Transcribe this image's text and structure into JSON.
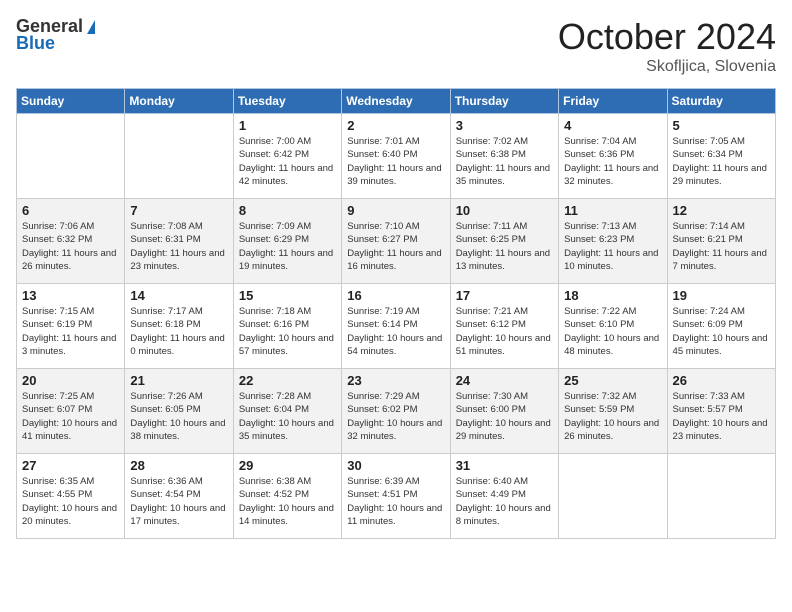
{
  "header": {
    "logo_general": "General",
    "logo_blue": "Blue",
    "title": "October 2024",
    "location": "Skofljica, Slovenia"
  },
  "weekdays": [
    "Sunday",
    "Monday",
    "Tuesday",
    "Wednesday",
    "Thursday",
    "Friday",
    "Saturday"
  ],
  "weeks": [
    [
      {
        "day": "",
        "sunrise": "",
        "sunset": "",
        "daylight": ""
      },
      {
        "day": "",
        "sunrise": "",
        "sunset": "",
        "daylight": ""
      },
      {
        "day": "1",
        "sunrise": "Sunrise: 7:00 AM",
        "sunset": "Sunset: 6:42 PM",
        "daylight": "Daylight: 11 hours and 42 minutes."
      },
      {
        "day": "2",
        "sunrise": "Sunrise: 7:01 AM",
        "sunset": "Sunset: 6:40 PM",
        "daylight": "Daylight: 11 hours and 39 minutes."
      },
      {
        "day": "3",
        "sunrise": "Sunrise: 7:02 AM",
        "sunset": "Sunset: 6:38 PM",
        "daylight": "Daylight: 11 hours and 35 minutes."
      },
      {
        "day": "4",
        "sunrise": "Sunrise: 7:04 AM",
        "sunset": "Sunset: 6:36 PM",
        "daylight": "Daylight: 11 hours and 32 minutes."
      },
      {
        "day": "5",
        "sunrise": "Sunrise: 7:05 AM",
        "sunset": "Sunset: 6:34 PM",
        "daylight": "Daylight: 11 hours and 29 minutes."
      }
    ],
    [
      {
        "day": "6",
        "sunrise": "Sunrise: 7:06 AM",
        "sunset": "Sunset: 6:32 PM",
        "daylight": "Daylight: 11 hours and 26 minutes."
      },
      {
        "day": "7",
        "sunrise": "Sunrise: 7:08 AM",
        "sunset": "Sunset: 6:31 PM",
        "daylight": "Daylight: 11 hours and 23 minutes."
      },
      {
        "day": "8",
        "sunrise": "Sunrise: 7:09 AM",
        "sunset": "Sunset: 6:29 PM",
        "daylight": "Daylight: 11 hours and 19 minutes."
      },
      {
        "day": "9",
        "sunrise": "Sunrise: 7:10 AM",
        "sunset": "Sunset: 6:27 PM",
        "daylight": "Daylight: 11 hours and 16 minutes."
      },
      {
        "day": "10",
        "sunrise": "Sunrise: 7:11 AM",
        "sunset": "Sunset: 6:25 PM",
        "daylight": "Daylight: 11 hours and 13 minutes."
      },
      {
        "day": "11",
        "sunrise": "Sunrise: 7:13 AM",
        "sunset": "Sunset: 6:23 PM",
        "daylight": "Daylight: 11 hours and 10 minutes."
      },
      {
        "day": "12",
        "sunrise": "Sunrise: 7:14 AM",
        "sunset": "Sunset: 6:21 PM",
        "daylight": "Daylight: 11 hours and 7 minutes."
      }
    ],
    [
      {
        "day": "13",
        "sunrise": "Sunrise: 7:15 AM",
        "sunset": "Sunset: 6:19 PM",
        "daylight": "Daylight: 11 hours and 3 minutes."
      },
      {
        "day": "14",
        "sunrise": "Sunrise: 7:17 AM",
        "sunset": "Sunset: 6:18 PM",
        "daylight": "Daylight: 11 hours and 0 minutes."
      },
      {
        "day": "15",
        "sunrise": "Sunrise: 7:18 AM",
        "sunset": "Sunset: 6:16 PM",
        "daylight": "Daylight: 10 hours and 57 minutes."
      },
      {
        "day": "16",
        "sunrise": "Sunrise: 7:19 AM",
        "sunset": "Sunset: 6:14 PM",
        "daylight": "Daylight: 10 hours and 54 minutes."
      },
      {
        "day": "17",
        "sunrise": "Sunrise: 7:21 AM",
        "sunset": "Sunset: 6:12 PM",
        "daylight": "Daylight: 10 hours and 51 minutes."
      },
      {
        "day": "18",
        "sunrise": "Sunrise: 7:22 AM",
        "sunset": "Sunset: 6:10 PM",
        "daylight": "Daylight: 10 hours and 48 minutes."
      },
      {
        "day": "19",
        "sunrise": "Sunrise: 7:24 AM",
        "sunset": "Sunset: 6:09 PM",
        "daylight": "Daylight: 10 hours and 45 minutes."
      }
    ],
    [
      {
        "day": "20",
        "sunrise": "Sunrise: 7:25 AM",
        "sunset": "Sunset: 6:07 PM",
        "daylight": "Daylight: 10 hours and 41 minutes."
      },
      {
        "day": "21",
        "sunrise": "Sunrise: 7:26 AM",
        "sunset": "Sunset: 6:05 PM",
        "daylight": "Daylight: 10 hours and 38 minutes."
      },
      {
        "day": "22",
        "sunrise": "Sunrise: 7:28 AM",
        "sunset": "Sunset: 6:04 PM",
        "daylight": "Daylight: 10 hours and 35 minutes."
      },
      {
        "day": "23",
        "sunrise": "Sunrise: 7:29 AM",
        "sunset": "Sunset: 6:02 PM",
        "daylight": "Daylight: 10 hours and 32 minutes."
      },
      {
        "day": "24",
        "sunrise": "Sunrise: 7:30 AM",
        "sunset": "Sunset: 6:00 PM",
        "daylight": "Daylight: 10 hours and 29 minutes."
      },
      {
        "day": "25",
        "sunrise": "Sunrise: 7:32 AM",
        "sunset": "Sunset: 5:59 PM",
        "daylight": "Daylight: 10 hours and 26 minutes."
      },
      {
        "day": "26",
        "sunrise": "Sunrise: 7:33 AM",
        "sunset": "Sunset: 5:57 PM",
        "daylight": "Daylight: 10 hours and 23 minutes."
      }
    ],
    [
      {
        "day": "27",
        "sunrise": "Sunrise: 6:35 AM",
        "sunset": "Sunset: 4:55 PM",
        "daylight": "Daylight: 10 hours and 20 minutes."
      },
      {
        "day": "28",
        "sunrise": "Sunrise: 6:36 AM",
        "sunset": "Sunset: 4:54 PM",
        "daylight": "Daylight: 10 hours and 17 minutes."
      },
      {
        "day": "29",
        "sunrise": "Sunrise: 6:38 AM",
        "sunset": "Sunset: 4:52 PM",
        "daylight": "Daylight: 10 hours and 14 minutes."
      },
      {
        "day": "30",
        "sunrise": "Sunrise: 6:39 AM",
        "sunset": "Sunset: 4:51 PM",
        "daylight": "Daylight: 10 hours and 11 minutes."
      },
      {
        "day": "31",
        "sunrise": "Sunrise: 6:40 AM",
        "sunset": "Sunset: 4:49 PM",
        "daylight": "Daylight: 10 hours and 8 minutes."
      },
      {
        "day": "",
        "sunrise": "",
        "sunset": "",
        "daylight": ""
      },
      {
        "day": "",
        "sunrise": "",
        "sunset": "",
        "daylight": ""
      }
    ]
  ]
}
